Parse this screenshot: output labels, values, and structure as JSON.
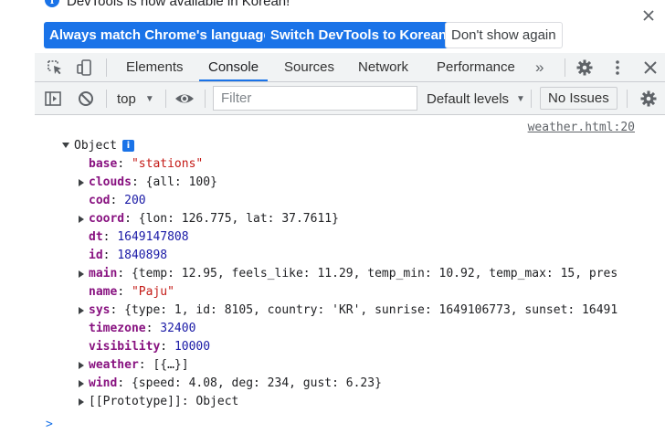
{
  "infobar": {
    "message": "DevTools is now available in Korean!",
    "buttons": {
      "match_language": "Always match Chrome's language",
      "switch_language": "Switch DevTools to Korean",
      "dont_show": "Don't show again"
    }
  },
  "tabs": [
    {
      "label": "Elements"
    },
    {
      "label": "Console"
    },
    {
      "label": "Sources"
    },
    {
      "label": "Network"
    },
    {
      "label": "Performance"
    }
  ],
  "more_tabs_label": "»",
  "console_toolbar": {
    "context": "top",
    "filter_placeholder": "Filter",
    "levels": "Default levels",
    "issues": "No Issues"
  },
  "console": {
    "source_link": "weather.html:20",
    "object_label": "Object",
    "info_badge": "i",
    "prompt": ">",
    "properties": [
      {
        "key": "base",
        "value": "\"stations\"",
        "value_color": "#c41a16",
        "expandable": false
      },
      {
        "key": "clouds",
        "value": "{all: 100}",
        "value_color": "#202124",
        "expandable": true
      },
      {
        "key": "cod",
        "value": "200",
        "value_color": "#1a1aa6",
        "expandable": false
      },
      {
        "key": "coord",
        "value": "{lon: 126.775, lat: 37.7611}",
        "value_color": "#202124",
        "expandable": true
      },
      {
        "key": "dt",
        "value": "1649147808",
        "value_color": "#1a1aa6",
        "expandable": false
      },
      {
        "key": "id",
        "value": "1840898",
        "value_color": "#1a1aa6",
        "expandable": false
      },
      {
        "key": "main",
        "value": "{temp: 12.95, feels_like: 11.29, temp_min: 10.92, temp_max: 15, pres",
        "value_color": "#202124",
        "expandable": true
      },
      {
        "key": "name",
        "value": "\"Paju\"",
        "value_color": "#c41a16",
        "expandable": false
      },
      {
        "key": "sys",
        "value": "{type: 1, id: 8105, country: 'KR', sunrise: 1649106773, sunset: 16491",
        "value_color": "#202124",
        "expandable": true
      },
      {
        "key": "timezone",
        "value": "32400",
        "value_color": "#1a1aa6",
        "expandable": false
      },
      {
        "key": "visibility",
        "value": "10000",
        "value_color": "#1a1aa6",
        "expandable": false
      },
      {
        "key": "weather",
        "value": "[{…}]",
        "value_color": "#202124",
        "expandable": true
      },
      {
        "key": "wind",
        "value": "{speed: 4.08, deg: 234, gust: 6.23}",
        "value_color": "#202124",
        "expandable": true
      },
      {
        "key": "[[Prototype]]",
        "value": "Object",
        "value_color": "#202124",
        "expandable": true,
        "proto": true
      }
    ]
  },
  "colors": {
    "accent": "#1a73e8",
    "key": "#881280",
    "string": "#c41a16",
    "number": "#1a1aa6"
  }
}
